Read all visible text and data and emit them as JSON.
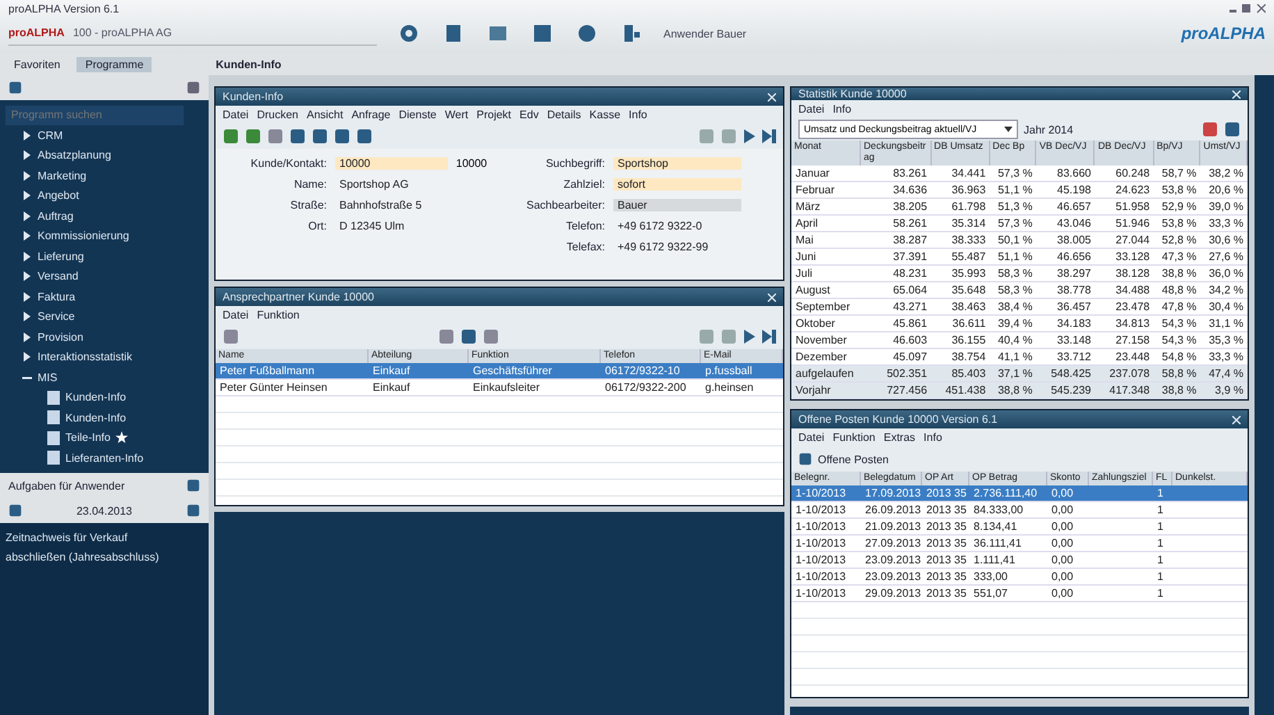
{
  "window": {
    "title": "proALPHA Version 6.1"
  },
  "toolbar": {
    "company_label": "proALPHA",
    "company": "100 - proALPHA AG",
    "user": "Anwender Bauer",
    "logo": "proALPHA"
  },
  "nav_tabs": [
    {
      "label": "Favoriten",
      "selected": false
    },
    {
      "label": "Programme",
      "selected": true
    }
  ],
  "breadcrumb": "Kunden-Info",
  "sidebar": {
    "search": {
      "placeholder": "Programm suchen"
    },
    "tree": [
      {
        "label": "CRM",
        "expanded": false
      },
      {
        "label": "Absatzplanung",
        "expanded": false
      },
      {
        "label": "Marketing",
        "expanded": false
      },
      {
        "label": "Angebot",
        "expanded": false
      },
      {
        "label": "Auftrag",
        "expanded": false
      },
      {
        "label": "Kommissionierung",
        "expanded": false
      },
      {
        "label": "Lieferung",
        "expanded": false
      },
      {
        "label": "Versand",
        "expanded": false
      },
      {
        "label": "Faktura",
        "expanded": false
      },
      {
        "label": "Service",
        "expanded": false
      },
      {
        "label": "Provision",
        "expanded": false
      },
      {
        "label": "Interaktionsstatistik",
        "expanded": false
      },
      {
        "label": "MIS",
        "expanded": true,
        "children": [
          {
            "label": "Kunden-Info",
            "favorite": false
          },
          {
            "label": "Kunden-Info",
            "favorite": false
          },
          {
            "label": "Teile-Info",
            "favorite": true
          },
          {
            "label": "Lieferanten-Info",
            "favorite": false
          }
        ]
      }
    ]
  },
  "tasks": {
    "title": "Aufgaben für Anwender",
    "date": "23.04.2013",
    "lines": [
      "Zeitnachweis für Verkauf",
      "abschließen (Jahresabschluss)"
    ]
  },
  "customer_info": {
    "title": "Kunden-Info",
    "menu": [
      "Datei",
      "Drucken",
      "Ansicht",
      "Anfrage",
      "Dienste",
      "Wert",
      "Projekt",
      "Edv",
      "Details",
      "Kasse",
      "Info"
    ],
    "left_fields": [
      {
        "label": "Kunde/Kontakt:",
        "value": "10000",
        "extra": "10000"
      },
      {
        "label": "Name:",
        "value": "Sportshop AG"
      },
      {
        "label": "Straße:",
        "value": "Bahnhofstraße 5"
      },
      {
        "label": "Ort:",
        "value": "D 12345 Ulm"
      }
    ],
    "right_fields": [
      {
        "label": "Suchbegriff:",
        "value": "Sportshop",
        "kind": "input"
      },
      {
        "label": "Zahlziel:",
        "value": "sofort",
        "kind": "input"
      },
      {
        "label": "Sachbearbeiter:",
        "value": "Bauer",
        "kind": "readonly"
      },
      {
        "label": "Telefon:",
        "value": "+49 6172 9322-0",
        "kind": "text"
      },
      {
        "label": "Telefax:",
        "value": "+49 6172 9322-99",
        "kind": "text"
      }
    ]
  },
  "contacts": {
    "title": "Ansprechpartner Kunde 10000",
    "menu": [
      "Datei",
      "Funktion"
    ],
    "columns": [
      "Name",
      "Abteilung",
      "Funktion",
      "Telefon",
      "E-Mail"
    ],
    "rows": [
      {
        "selected": true,
        "cells": [
          "Peter Fußballmann",
          "Einkauf",
          "Geschäftsführer",
          "06172/9322-10",
          "p.fussball"
        ]
      },
      {
        "selected": false,
        "cells": [
          "Peter Günter Heinsen",
          "Einkauf",
          "Einkaufsleiter",
          "06172/9322-200",
          "g.heinsen"
        ]
      }
    ]
  },
  "statistics": {
    "title": "Statistik Kunde 10000",
    "menu": [
      "Datei",
      "Info"
    ],
    "dropdown": "Umsatz und Deckungsbeitrag aktuell/VJ",
    "year": "Jahr 2014",
    "columns": [
      "Monat",
      "Deckungsbeitrag",
      "DB Umsatz",
      "Dec Bp",
      "VB Dec/VJ",
      "DB Dec/VJ",
      "Bp/VJ",
      "Umst/VJ"
    ],
    "rows": [
      {
        "kind": "month",
        "cells": [
          "Januar",
          "83.261",
          "34.441",
          "57,3 %",
          "83.660",
          "60.248",
          "58,7 %",
          "38,2 %"
        ]
      },
      {
        "kind": "month",
        "cells": [
          "Februar",
          "34.636",
          "36.963",
          "51,1 %",
          "45.198",
          "24.623",
          "53,8 %",
          "20,6 %"
        ]
      },
      {
        "kind": "month",
        "cells": [
          "März",
          "38.205",
          "61.798",
          "51,3 %",
          "46.657",
          "51.958",
          "52,9 %",
          "39,0 %"
        ]
      },
      {
        "kind": "month",
        "cells": [
          "April",
          "58.261",
          "35.314",
          "57,3 %",
          "43.046",
          "51.946",
          "53,8 %",
          "33,3 %"
        ]
      },
      {
        "kind": "month",
        "cells": [
          "Mai",
          "38.287",
          "38.333",
          "50,1 %",
          "38.005",
          "27.044",
          "52,8 %",
          "30,6 %"
        ]
      },
      {
        "kind": "month",
        "cells": [
          "Juni",
          "37.391",
          "55.487",
          "51,1 %",
          "46.656",
          "33.128",
          "47,3 %",
          "27,6 %"
        ]
      },
      {
        "kind": "month",
        "cells": [
          "Juli",
          "48.231",
          "35.993",
          "58,3 %",
          "38.297",
          "38.128",
          "38,8 %",
          "36,0 %"
        ]
      },
      {
        "kind": "month",
        "cells": [
          "August",
          "65.064",
          "35.648",
          "58,3 %",
          "38.778",
          "34.488",
          "48,8 %",
          "34,2 %"
        ]
      },
      {
        "kind": "month",
        "cells": [
          "September",
          "43.271",
          "38.463",
          "38,4 %",
          "36.457",
          "23.478",
          "47,8 %",
          "30,4 %"
        ]
      },
      {
        "kind": "month",
        "cells": [
          "Oktober",
          "45.861",
          "36.611",
          "39,4 %",
          "34.183",
          "34.813",
          "54,3 %",
          "31,1 %"
        ]
      },
      {
        "kind": "month",
        "cells": [
          "November",
          "46.603",
          "36.155",
          "40,4 %",
          "33.148",
          "27.158",
          "54,3 %",
          "35,3 %"
        ]
      },
      {
        "kind": "month",
        "cells": [
          "Dezember",
          "45.097",
          "38.754",
          "41,1 %",
          "33.712",
          "23.448",
          "54,8 %",
          "33,3 %"
        ]
      },
      {
        "kind": "total",
        "cells": [
          "aufgelaufen",
          "502.351",
          "85.403",
          "37,1 %",
          "548.425",
          "237.078",
          "58,8 %",
          "47,4 %"
        ]
      },
      {
        "kind": "total",
        "cells": [
          "Vorjahr",
          "727.456",
          "451.438",
          "38,8 %",
          "545.239",
          "417.348",
          "38,8 %",
          "3,9 %"
        ]
      }
    ]
  },
  "open_items": {
    "title": "Offene Posten Kunde 10000 Version 6.1",
    "menu": [
      "Datei",
      "Funktion",
      "Extras",
      "Info"
    ],
    "filter": "Offene Posten",
    "columns": [
      "Belegnr.",
      "Belegdatum",
      "OP Art",
      "OP Betrag",
      "Skonto",
      "Zahlungsziel",
      "FL",
      "Dunkelst."
    ],
    "rows": [
      {
        "selected": true,
        "cells": [
          "1-10/2013",
          "17.09.2013",
          "2013 35",
          "2.736.111,40",
          "0,00",
          "",
          "1",
          ""
        ]
      },
      {
        "selected": false,
        "cells": [
          "1-10/2013",
          "26.09.2013",
          "2013 35",
          "84.333,00",
          "0,00",
          "",
          "1",
          ""
        ]
      },
      {
        "selected": false,
        "cells": [
          "1-10/2013",
          "21.09.2013",
          "2013 35",
          "8.134,41",
          "0,00",
          "",
          "1",
          ""
        ]
      },
      {
        "selected": false,
        "cells": [
          "1-10/2013",
          "27.09.2013",
          "2013 35",
          "36.111,41",
          "0,00",
          "",
          "1",
          ""
        ]
      },
      {
        "selected": false,
        "cells": [
          "1-10/2013",
          "23.09.2013",
          "2013 35",
          "1.111,41",
          "0,00",
          "",
          "1",
          ""
        ]
      },
      {
        "selected": false,
        "cells": [
          "1-10/2013",
          "23.09.2013",
          "2013 35",
          "333,00",
          "0,00",
          "",
          "1",
          ""
        ]
      },
      {
        "selected": false,
        "cells": [
          "1-10/2013",
          "29.09.2013",
          "2013 35",
          "551,07",
          "0,00",
          "",
          "1",
          ""
        ]
      }
    ]
  }
}
